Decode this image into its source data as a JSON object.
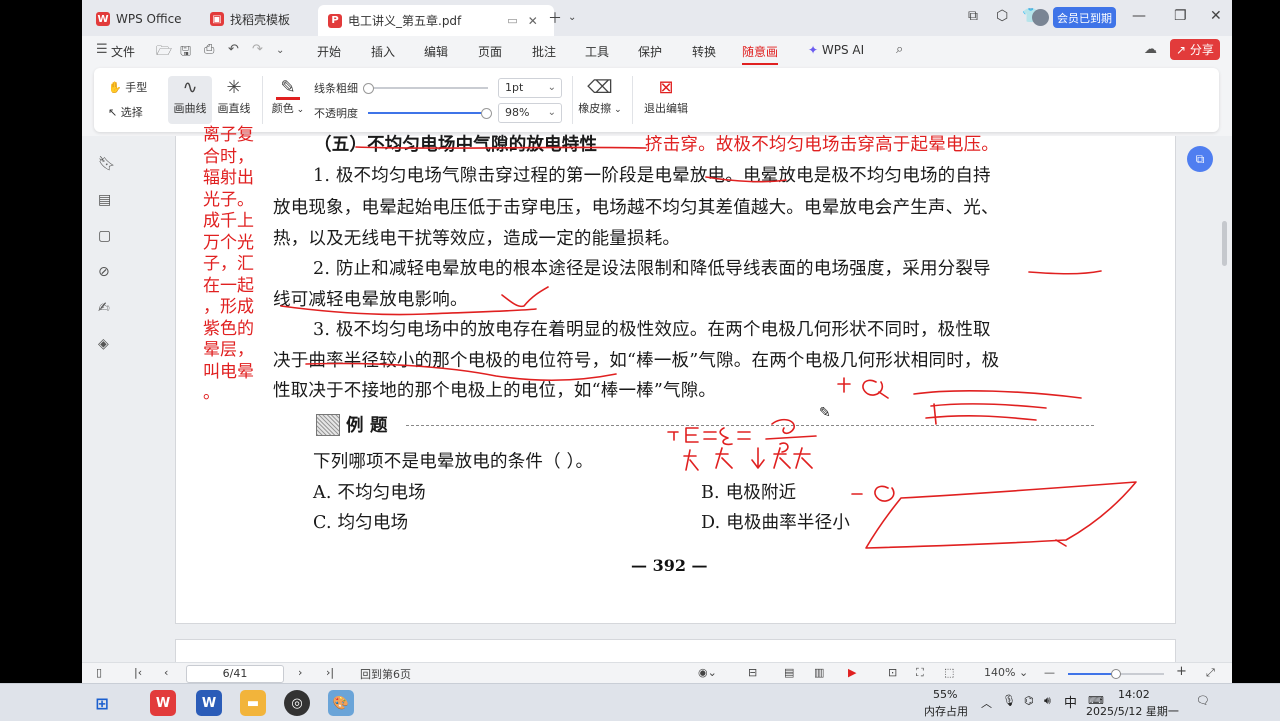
{
  "tabs": [
    {
      "label": "WPS Office",
      "icon": "wps-logo-icon"
    },
    {
      "label": "找稻壳模板",
      "icon": "template-icon"
    },
    {
      "label": "电工讲义_第五章.pdf",
      "icon": "pdf-icon",
      "active": true
    }
  ],
  "titlebar": {
    "member_label": "会员已到期"
  },
  "menu": {
    "file_label": "文件",
    "items": [
      "开始",
      "插入",
      "编辑",
      "页面",
      "批注",
      "工具",
      "保护",
      "转换",
      "随意画"
    ],
    "selected": "随意画",
    "wps_ai_label": "WPS AI",
    "share_label": "分享"
  },
  "ribbon": {
    "hand_label": "手型",
    "select_label": "选择",
    "curve_label": "画曲线",
    "line_label": "画直线",
    "color_label": "颜色",
    "thickness_label": "线条粗细",
    "opacity_label": "不透明度",
    "thickness_value": "1pt",
    "opacity_value": "98%",
    "thickness_fraction": 0.0,
    "opacity_fraction": 0.98,
    "eraser_label": "橡皮擦",
    "exit_label": "退出编辑",
    "pen_color": "#e02020"
  },
  "document": {
    "heading_partial": "（五）不均匀电场中气隙的放电特性",
    "heading_margin_note": "挤击穿。故极不均匀电场击穿高于起晕电压。",
    "lines": [
      "1. 极不均匀电场气隙击穿过程的第一阶段是电晕放电。电晕放电是极不均匀电场的自持",
      "放电现象，电晕起始电压低于击穿电压，电场越不均匀其差值越大。电晕放电会产生声、光、",
      "热，以及无线电干扰等效应，造成一定的能量损耗。",
      "2. 防止和减轻电晕放电的根本途径是设法限制和降低导线表面的电场强度，采用分裂导",
      "线可减轻电晕放电影响。",
      "3. 极不均匀电场中的放电存在着明显的极性效应。在两个电极几何形状不同时，极性取",
      "决于曲率半径较小的那个电极的电位符号，如“棒一板”气隙。在两个电极几何形状相同时，极",
      "性取决于不接地的那个电极上的电位，如“棒一棒”气隙。"
    ],
    "margin_note_lines": [
      "离子复",
      "合时，",
      "辐射出",
      "光子。",
      "成千上",
      "万个光",
      "子，汇",
      "在一起",
      "，形成",
      "紫色的",
      "晕层，",
      "叫电晕",
      "。"
    ],
    "example_label": "例  题",
    "question": "下列哪项不是电晕放电的条件（      ）。",
    "options": [
      "A. 不均匀电场",
      "B. 电极附近",
      "C. 均匀电场",
      "D. 电极曲率半径小"
    ],
    "page_number": "— 392 —"
  },
  "statusbar": {
    "page_indicator": "6/41",
    "back_label": "回到第6页",
    "zoom": "140%",
    "zoom_fraction": 0.5
  },
  "taskbar": {
    "memory_percent": "55%",
    "memory_label": "内存占用",
    "ime_label": "中",
    "time": "14:02",
    "date": "2025/5/12 星期一"
  }
}
